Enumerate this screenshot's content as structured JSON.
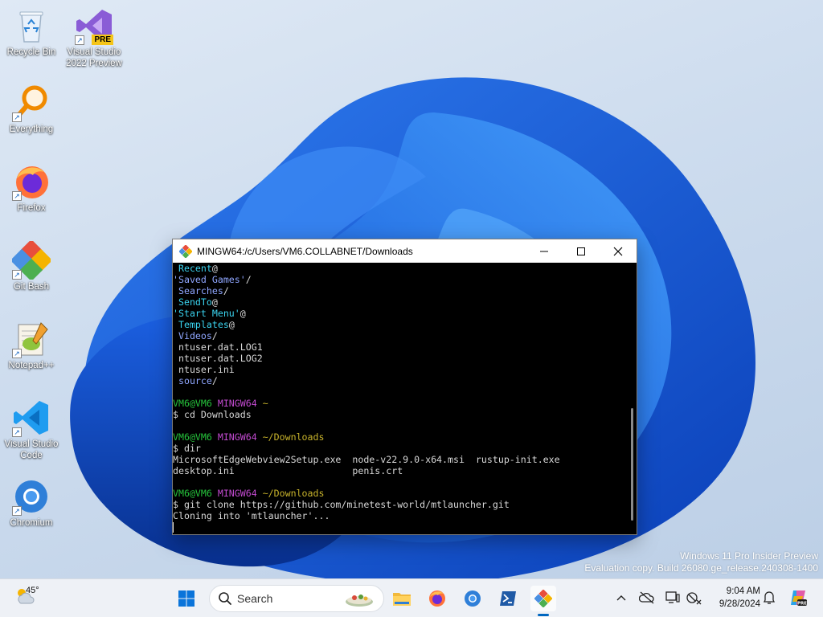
{
  "desktop": {
    "icons": [
      {
        "id": "recycle-bin",
        "label": "Recycle Bin",
        "icon": "recycle-bin-icon"
      },
      {
        "id": "visual-studio",
        "label": "Visual Studio 2022 Preview",
        "badge": "PRE",
        "icon": "visual-studio-icon"
      },
      {
        "id": "everything",
        "label": "Everything",
        "icon": "magnifier-icon"
      },
      {
        "id": "firefox",
        "label": "Firefox",
        "icon": "firefox-icon"
      },
      {
        "id": "git-bash",
        "label": "Git Bash",
        "icon": "git-bash-icon"
      },
      {
        "id": "notepadpp",
        "label": "Notepad++",
        "icon": "notepadpp-icon"
      },
      {
        "id": "vscode",
        "label": "Visual Studio Code",
        "icon": "vscode-icon"
      },
      {
        "id": "chromium",
        "label": "Chromium",
        "icon": "chromium-icon"
      }
    ],
    "watermark": {
      "line1": "Windows 11 Pro Insider Preview",
      "line2": "Evaluation copy. Build 26080.ge_release.240308-1400"
    }
  },
  "terminal": {
    "title": "MINGW64:/c/Users/VM6.COLLABNET/Downloads",
    "lines": [
      [
        {
          "t": " Recent",
          "c": "cyan"
        },
        {
          "t": "@",
          "c": "white"
        }
      ],
      [
        {
          "t": "'Saved Games'",
          "c": "blue"
        },
        {
          "t": "/",
          "c": "white"
        }
      ],
      [
        {
          "t": " Searches",
          "c": "blue"
        },
        {
          "t": "/",
          "c": "white"
        }
      ],
      [
        {
          "t": " SendTo",
          "c": "cyan"
        },
        {
          "t": "@",
          "c": "white"
        }
      ],
      [
        {
          "t": "'Start Menu'",
          "c": "cyan"
        },
        {
          "t": "@",
          "c": "white"
        }
      ],
      [
        {
          "t": " Templates",
          "c": "cyan"
        },
        {
          "t": "@",
          "c": "white"
        }
      ],
      [
        {
          "t": " Videos",
          "c": "blue"
        },
        {
          "t": "/",
          "c": "white"
        }
      ],
      [
        {
          "t": " ntuser.dat.LOG1",
          "c": "white"
        }
      ],
      [
        {
          "t": " ntuser.dat.LOG2",
          "c": "white"
        }
      ],
      [
        {
          "t": " ntuser.ini",
          "c": "white"
        }
      ],
      [
        {
          "t": " source",
          "c": "blue"
        },
        {
          "t": "/",
          "c": "white"
        }
      ],
      [],
      [
        {
          "t": "VM6@VM6 ",
          "c": "green"
        },
        {
          "t": "MINGW64 ",
          "c": "mag"
        },
        {
          "t": "~",
          "c": "yel"
        }
      ],
      [
        {
          "t": "$ cd Downloads",
          "c": "white"
        }
      ],
      [],
      [
        {
          "t": "VM6@VM6 ",
          "c": "green"
        },
        {
          "t": "MINGW64 ",
          "c": "mag"
        },
        {
          "t": "~/Downloads",
          "c": "yel"
        }
      ],
      [
        {
          "t": "$ dir",
          "c": "white"
        }
      ],
      [
        {
          "t": "MicrosoftEdgeWebview2Setup.exe  node-v22.9.0-x64.msi  rustup-init.exe",
          "c": "white"
        }
      ],
      [
        {
          "t": "desktop.ini                     penis.crt",
          "c": "white"
        }
      ],
      [],
      [
        {
          "t": "VM6@VM6 ",
          "c": "green"
        },
        {
          "t": "MINGW64 ",
          "c": "mag"
        },
        {
          "t": "~/Downloads",
          "c": "yel"
        }
      ],
      [
        {
          "t": "$ git clone https://github.com/minetest-world/mtlauncher.git",
          "c": "white"
        }
      ],
      [
        {
          "t": "Cloning into 'mtlauncher'...",
          "c": "white"
        }
      ],
      [
        {
          "cursor": true
        }
      ]
    ]
  },
  "taskbar": {
    "weather": {
      "temp": "45°",
      "icon": "partly-cloudy-icon"
    },
    "search": {
      "label": "Search"
    },
    "apps": [
      {
        "id": "start",
        "icon": "windows-start-icon"
      },
      {
        "id": "file-explorer",
        "icon": "folder-icon"
      },
      {
        "id": "firefox",
        "icon": "firefox-icon"
      },
      {
        "id": "chromium",
        "icon": "chromium-icon"
      },
      {
        "id": "powershell",
        "icon": "powershell-icon"
      },
      {
        "id": "git-bash",
        "icon": "git-bash-icon",
        "active": true
      }
    ],
    "clock": {
      "time": "9:04 AM",
      "date": "9/28/2024"
    }
  },
  "colors": {
    "accent": "#0067c0",
    "terminal_bg": "#000000",
    "prompt_user": "#25c13b",
    "prompt_host": "#c34bd1",
    "prompt_path": "#c8b32b",
    "symlink": "#3ad4f0",
    "directory": "#8fa6ff"
  }
}
